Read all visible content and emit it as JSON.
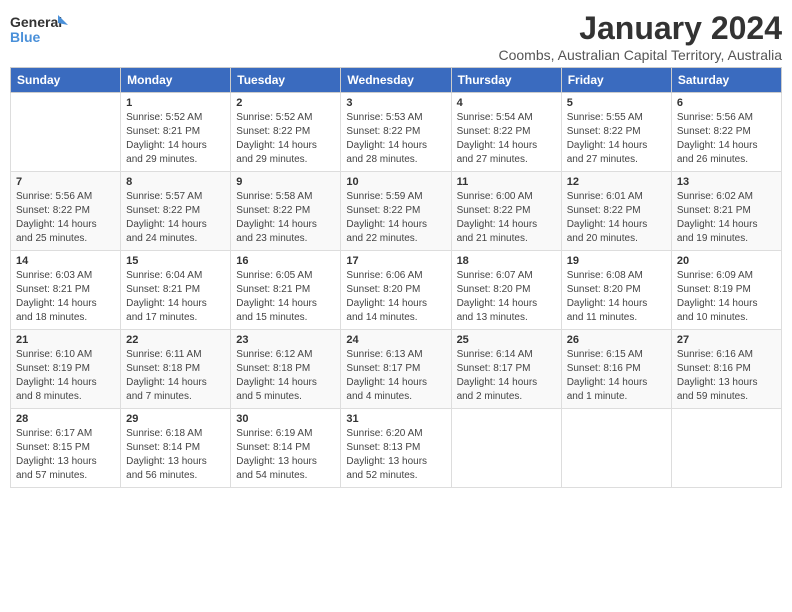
{
  "logo": {
    "line1": "General",
    "line2": "Blue"
  },
  "title": "January 2024",
  "subtitle": "Coombs, Australian Capital Territory, Australia",
  "days_header": [
    "Sunday",
    "Monday",
    "Tuesday",
    "Wednesday",
    "Thursday",
    "Friday",
    "Saturday"
  ],
  "weeks": [
    [
      {
        "day": "",
        "info": ""
      },
      {
        "day": "1",
        "info": "Sunrise: 5:52 AM\nSunset: 8:21 PM\nDaylight: 14 hours\nand 29 minutes."
      },
      {
        "day": "2",
        "info": "Sunrise: 5:52 AM\nSunset: 8:22 PM\nDaylight: 14 hours\nand 29 minutes."
      },
      {
        "day": "3",
        "info": "Sunrise: 5:53 AM\nSunset: 8:22 PM\nDaylight: 14 hours\nand 28 minutes."
      },
      {
        "day": "4",
        "info": "Sunrise: 5:54 AM\nSunset: 8:22 PM\nDaylight: 14 hours\nand 27 minutes."
      },
      {
        "day": "5",
        "info": "Sunrise: 5:55 AM\nSunset: 8:22 PM\nDaylight: 14 hours\nand 27 minutes."
      },
      {
        "day": "6",
        "info": "Sunrise: 5:56 AM\nSunset: 8:22 PM\nDaylight: 14 hours\nand 26 minutes."
      }
    ],
    [
      {
        "day": "7",
        "info": "Sunrise: 5:56 AM\nSunset: 8:22 PM\nDaylight: 14 hours\nand 25 minutes."
      },
      {
        "day": "8",
        "info": "Sunrise: 5:57 AM\nSunset: 8:22 PM\nDaylight: 14 hours\nand 24 minutes."
      },
      {
        "day": "9",
        "info": "Sunrise: 5:58 AM\nSunset: 8:22 PM\nDaylight: 14 hours\nand 23 minutes."
      },
      {
        "day": "10",
        "info": "Sunrise: 5:59 AM\nSunset: 8:22 PM\nDaylight: 14 hours\nand 22 minutes."
      },
      {
        "day": "11",
        "info": "Sunrise: 6:00 AM\nSunset: 8:22 PM\nDaylight: 14 hours\nand 21 minutes."
      },
      {
        "day": "12",
        "info": "Sunrise: 6:01 AM\nSunset: 8:22 PM\nDaylight: 14 hours\nand 20 minutes."
      },
      {
        "day": "13",
        "info": "Sunrise: 6:02 AM\nSunset: 8:21 PM\nDaylight: 14 hours\nand 19 minutes."
      }
    ],
    [
      {
        "day": "14",
        "info": "Sunrise: 6:03 AM\nSunset: 8:21 PM\nDaylight: 14 hours\nand 18 minutes."
      },
      {
        "day": "15",
        "info": "Sunrise: 6:04 AM\nSunset: 8:21 PM\nDaylight: 14 hours\nand 17 minutes."
      },
      {
        "day": "16",
        "info": "Sunrise: 6:05 AM\nSunset: 8:21 PM\nDaylight: 14 hours\nand 15 minutes."
      },
      {
        "day": "17",
        "info": "Sunrise: 6:06 AM\nSunset: 8:20 PM\nDaylight: 14 hours\nand 14 minutes."
      },
      {
        "day": "18",
        "info": "Sunrise: 6:07 AM\nSunset: 8:20 PM\nDaylight: 14 hours\nand 13 minutes."
      },
      {
        "day": "19",
        "info": "Sunrise: 6:08 AM\nSunset: 8:20 PM\nDaylight: 14 hours\nand 11 minutes."
      },
      {
        "day": "20",
        "info": "Sunrise: 6:09 AM\nSunset: 8:19 PM\nDaylight: 14 hours\nand 10 minutes."
      }
    ],
    [
      {
        "day": "21",
        "info": "Sunrise: 6:10 AM\nSunset: 8:19 PM\nDaylight: 14 hours\nand 8 minutes."
      },
      {
        "day": "22",
        "info": "Sunrise: 6:11 AM\nSunset: 8:18 PM\nDaylight: 14 hours\nand 7 minutes."
      },
      {
        "day": "23",
        "info": "Sunrise: 6:12 AM\nSunset: 8:18 PM\nDaylight: 14 hours\nand 5 minutes."
      },
      {
        "day": "24",
        "info": "Sunrise: 6:13 AM\nSunset: 8:17 PM\nDaylight: 14 hours\nand 4 minutes."
      },
      {
        "day": "25",
        "info": "Sunrise: 6:14 AM\nSunset: 8:17 PM\nDaylight: 14 hours\nand 2 minutes."
      },
      {
        "day": "26",
        "info": "Sunrise: 6:15 AM\nSunset: 8:16 PM\nDaylight: 14 hours\nand 1 minute."
      },
      {
        "day": "27",
        "info": "Sunrise: 6:16 AM\nSunset: 8:16 PM\nDaylight: 13 hours\nand 59 minutes."
      }
    ],
    [
      {
        "day": "28",
        "info": "Sunrise: 6:17 AM\nSunset: 8:15 PM\nDaylight: 13 hours\nand 57 minutes."
      },
      {
        "day": "29",
        "info": "Sunrise: 6:18 AM\nSunset: 8:14 PM\nDaylight: 13 hours\nand 56 minutes."
      },
      {
        "day": "30",
        "info": "Sunrise: 6:19 AM\nSunset: 8:14 PM\nDaylight: 13 hours\nand 54 minutes."
      },
      {
        "day": "31",
        "info": "Sunrise: 6:20 AM\nSunset: 8:13 PM\nDaylight: 13 hours\nand 52 minutes."
      },
      {
        "day": "",
        "info": ""
      },
      {
        "day": "",
        "info": ""
      },
      {
        "day": "",
        "info": ""
      }
    ]
  ]
}
